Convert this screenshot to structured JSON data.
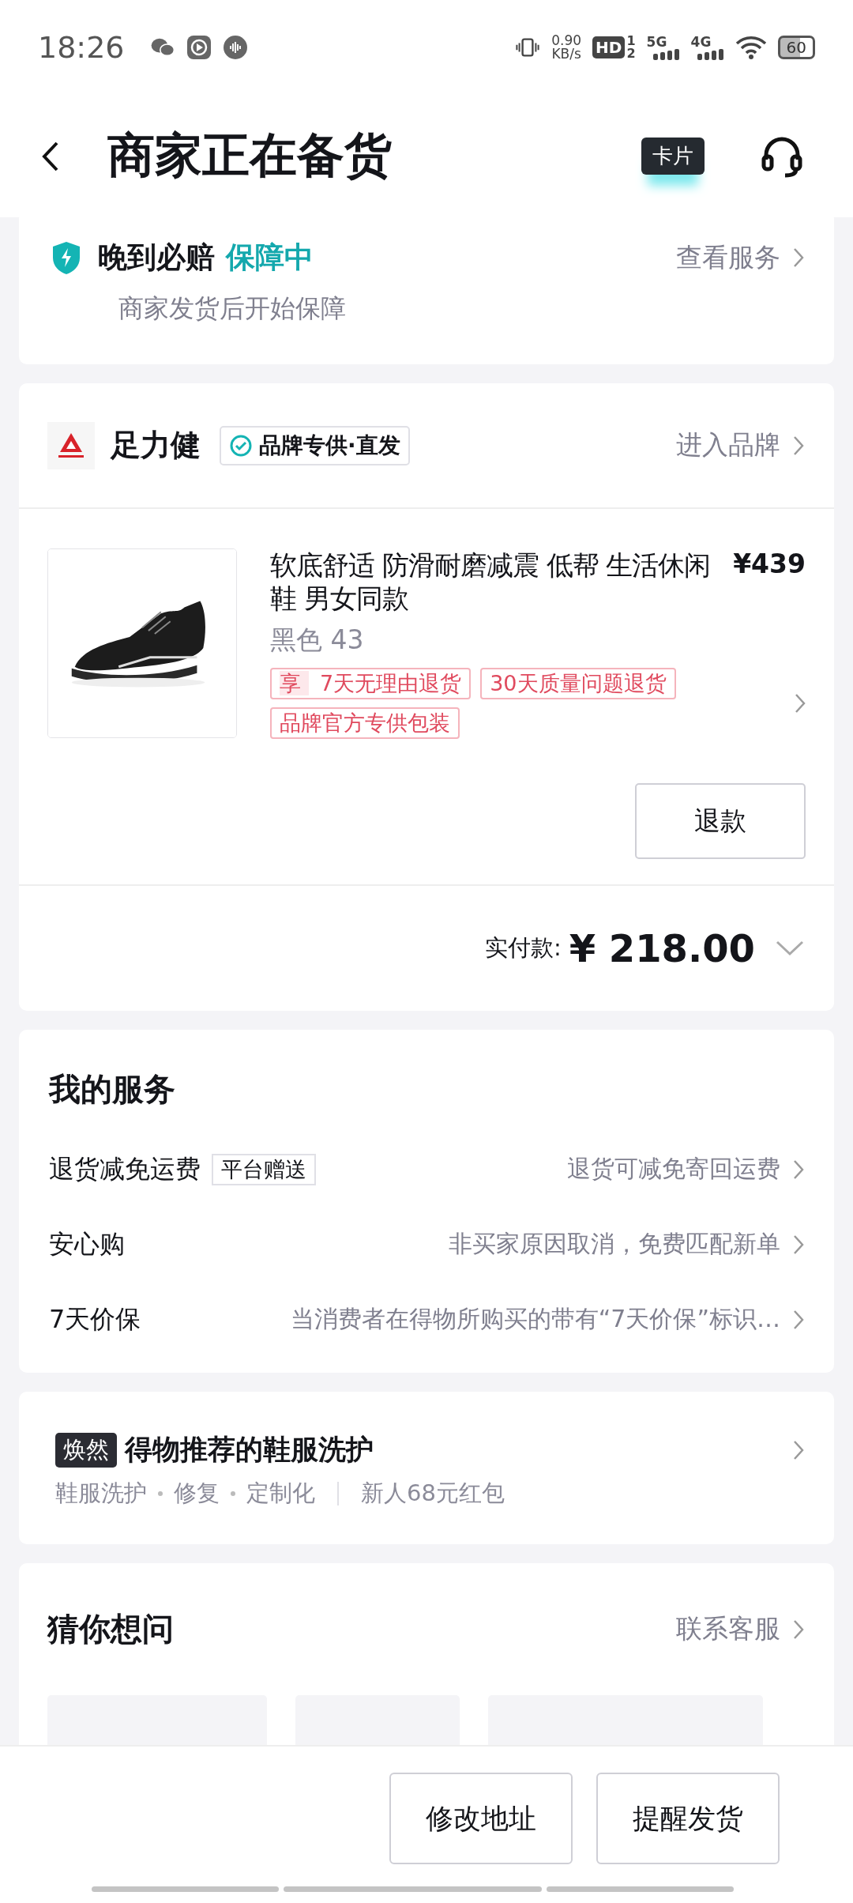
{
  "status_bar": {
    "time": "18:26",
    "net_speed": "0.90",
    "net_unit": "KB/s",
    "hd": "HD",
    "sim_1": "1",
    "sim_2": "2",
    "network_1": "5G",
    "network_2": "4G",
    "battery": "60"
  },
  "header": {
    "title": "商家正在备货",
    "card_button": "卡片"
  },
  "guarantee": {
    "title": "晚到必赔",
    "status": "保障中",
    "subtitle": "商家发货后开始保障",
    "link": "查看服务"
  },
  "order": {
    "brand": {
      "name": "足力健",
      "badge": "品牌专供·直发",
      "link": "进入品牌"
    },
    "product": {
      "title": "软底舒适 防滑耐磨减震 低帮 生活休闲鞋 男女同款",
      "spec": "黑色 43",
      "price": "¥439",
      "tags": [
        {
          "prefix": "享",
          "text": "7天无理由退货"
        },
        {
          "text": "30天质量问题退货"
        },
        {
          "text": "品牌官方专供包装"
        }
      ],
      "refund_button": "退款"
    },
    "paid_label": "实付款:",
    "paid_amount": "¥ 218.00"
  },
  "services": {
    "title": "我的服务",
    "rows": [
      {
        "label": "退货减免运费",
        "tag": "平台赠送",
        "value": "退货可减免寄回运费"
      },
      {
        "label": "安心购",
        "value": "非买家原因取消，免费匹配新单"
      },
      {
        "label": "7天价保",
        "value": "当消费者在得物所购买的带有“7天价保”标识…"
      }
    ]
  },
  "care": {
    "badge": "焕然",
    "title": "得物推荐的鞋服洗护",
    "features": [
      "鞋服洗护",
      "修复",
      "定制化"
    ],
    "promo": "新人68元红包"
  },
  "questions": {
    "title": "猜你想问",
    "link": "联系客服"
  },
  "bottom_bar": {
    "buttons": [
      "修改地址",
      "提醒发货"
    ]
  }
}
